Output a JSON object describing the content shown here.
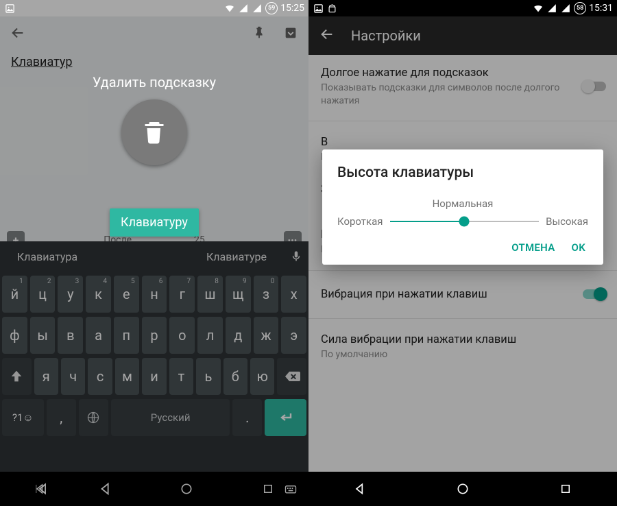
{
  "left": {
    "status": {
      "battery": "59",
      "time": "15:25"
    },
    "note_text": "Клавиатур",
    "delete_hint": "Удалить подсказку",
    "footer": {
      "prefix": "После",
      "suffix": "25"
    },
    "drag_chip": "Клавиатуру",
    "suggestions": {
      "left": "Клавиатура",
      "center": "",
      "right": "Клавиатуре"
    },
    "keyboard": {
      "row1": [
        {
          "k": "й",
          "s": "1"
        },
        {
          "k": "ц",
          "s": "2"
        },
        {
          "k": "у",
          "s": "3"
        },
        {
          "k": "к",
          "s": "4"
        },
        {
          "k": "е",
          "s": "5"
        },
        {
          "k": "н",
          "s": "6"
        },
        {
          "k": "г",
          "s": "7"
        },
        {
          "k": "ш",
          "s": "8"
        },
        {
          "k": "щ",
          "s": "9"
        },
        {
          "k": "з",
          "s": "0"
        },
        {
          "k": "х",
          "s": ""
        }
      ],
      "row2": [
        {
          "k": "ф"
        },
        {
          "k": "ы"
        },
        {
          "k": "в"
        },
        {
          "k": "а"
        },
        {
          "k": "п"
        },
        {
          "k": "р"
        },
        {
          "k": "о"
        },
        {
          "k": "л"
        },
        {
          "k": "д"
        },
        {
          "k": "ж"
        },
        {
          "k": "э"
        }
      ],
      "row3": [
        {
          "k": "я"
        },
        {
          "k": "ч"
        },
        {
          "k": "с"
        },
        {
          "k": "м"
        },
        {
          "k": "и"
        },
        {
          "k": "т"
        },
        {
          "k": "ь"
        },
        {
          "k": "б"
        },
        {
          "k": "ю"
        }
      ],
      "sym_label": "?1☺",
      "comma": ",",
      "space_label": "Русский",
      "period": "."
    }
  },
  "right": {
    "status": {
      "battery": "58",
      "time": "15:31"
    },
    "appbar_title": "Настройки",
    "settings": [
      {
        "title": "Долгое нажатие для подсказок",
        "sub": "Показывать подсказки для символов после долгого нажатия",
        "switch": "off"
      },
      {
        "title": "В",
        "sub": "Н"
      },
      {
        "title": "З"
      },
      {
        "title": "Громкость звука при нажатии",
        "sub": "По умолчанию"
      },
      {
        "title": "Вибрация при нажатии клавиш",
        "switch": "on"
      },
      {
        "title": "Сила вибрации при нажатии клавиш",
        "sub": "По умолчанию"
      }
    ],
    "dialog": {
      "title": "Высота клавиатуры",
      "value_label": "Нормальная",
      "min_label": "Короткая",
      "max_label": "Высокая",
      "cancel": "ОТМЕНА",
      "ok": "OK"
    }
  }
}
